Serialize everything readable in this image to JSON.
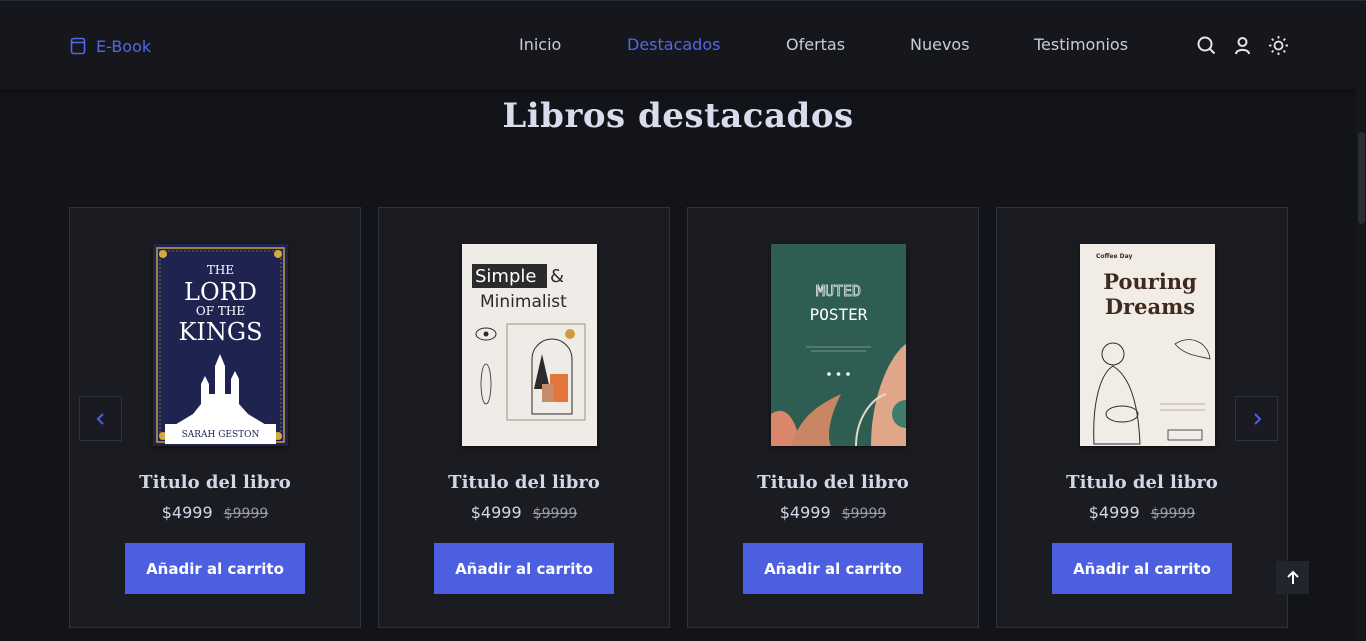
{
  "header": {
    "logo_text": "E-Book",
    "logo_icon": "book-icon",
    "nav": [
      {
        "label": "Inicio",
        "active": false
      },
      {
        "label": "Destacados",
        "active": true
      },
      {
        "label": "Ofertas",
        "active": false
      },
      {
        "label": "Nuevos",
        "active": false
      },
      {
        "label": "Testimonios",
        "active": false
      }
    ],
    "icons": [
      "search-icon",
      "user-icon",
      "sun-icon"
    ]
  },
  "section": {
    "title": "Libros destacados"
  },
  "books": [
    {
      "title": "Titulo del libro",
      "price": "$4999",
      "old_price": "$9999",
      "button": "Añadir al carrito",
      "cover": {
        "top1": "THE",
        "top2": "LORD",
        "top3": "OF THE",
        "top4": "KINGS",
        "author": "SARAH GESTON"
      }
    },
    {
      "title": "Titulo del libro",
      "price": "$4999",
      "old_price": "$9999",
      "button": "Añadir al carrito",
      "cover": {
        "line1": "Simple",
        "amp": "&",
        "line2": "Minimalist"
      }
    },
    {
      "title": "Titulo del libro",
      "price": "$4999",
      "old_price": "$9999",
      "button": "Añadir al carrito",
      "cover": {
        "line1": "MUTED",
        "line2": "POSTER"
      }
    },
    {
      "title": "Titulo del libro",
      "price": "$4999",
      "old_price": "$9999",
      "button": "Añadir al carrito",
      "cover": {
        "line1": "Pouring",
        "line2": "Dreams",
        "brand": "Coffee Day"
      }
    }
  ],
  "carousel": {
    "prev_icon": "chevron-left-icon",
    "next_icon": "chevron-right-icon"
  },
  "scroll_top_icon": "arrow-up-icon",
  "colors": {
    "accent": "#4c5fe0",
    "background": "#131419",
    "card": "#1b1c22"
  }
}
